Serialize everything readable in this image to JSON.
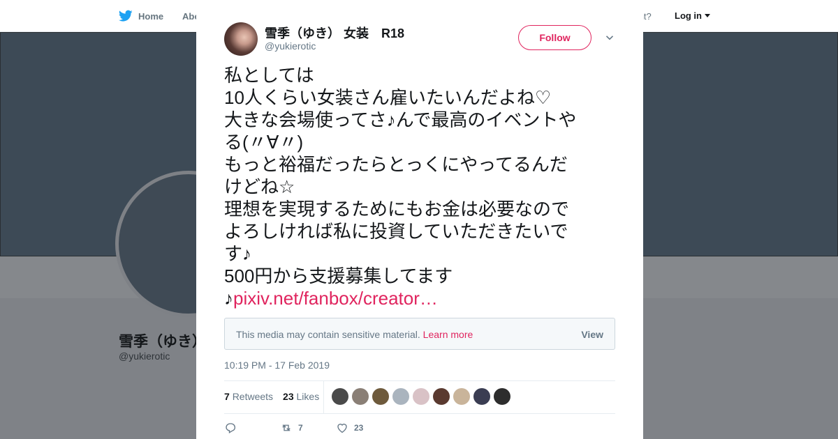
{
  "nav": {
    "home_label": "Home",
    "about_label": "Abo",
    "account_prompt": "account?",
    "login_label": "Log in"
  },
  "profile": {
    "name": "雪季（ゆき）",
    "handle": "@yukierotic"
  },
  "tweet": {
    "author_name": "雪季（ゆき） 女装　R18",
    "author_handle": "@yukierotic",
    "follow_label": "Follow",
    "text_lines": [
      "私としては",
      "10人くらい女装さん雇いたいんだよね♡",
      "大きな会場使ってさ♪んで最高のイベントや",
      "る(〃∀〃)",
      "もっと裕福だったらとっくにやってるんだ",
      "けどね☆",
      "理想を実現するためにもお金は必要なので",
      "よろしければ私に投資していただきたいで",
      "す♪",
      "500円から支援募集してます"
    ],
    "link_prefix": "♪",
    "link_text": "pixiv.net/fanbox/creator…",
    "sensitive_notice": "This media may contain sensitive material.",
    "learn_more_label": "Learn more",
    "view_label": "View",
    "timestamp": "10:19 PM - 17 Feb 2019",
    "retweets_count": "7",
    "retweets_label": "Retweets",
    "likes_count": "23",
    "likes_label": "Likes",
    "action_retweet_count": "7",
    "action_like_count": "23"
  },
  "colors": {
    "accent": "#e0245e",
    "secondary_text": "#657786",
    "primary_text": "#14171a"
  },
  "icons": {
    "logo": "twitter-bird-icon",
    "close": "close-icon",
    "chevron": "chevron-down-icon",
    "reply": "reply-icon",
    "retweet": "retweet-icon",
    "like": "heart-icon"
  }
}
